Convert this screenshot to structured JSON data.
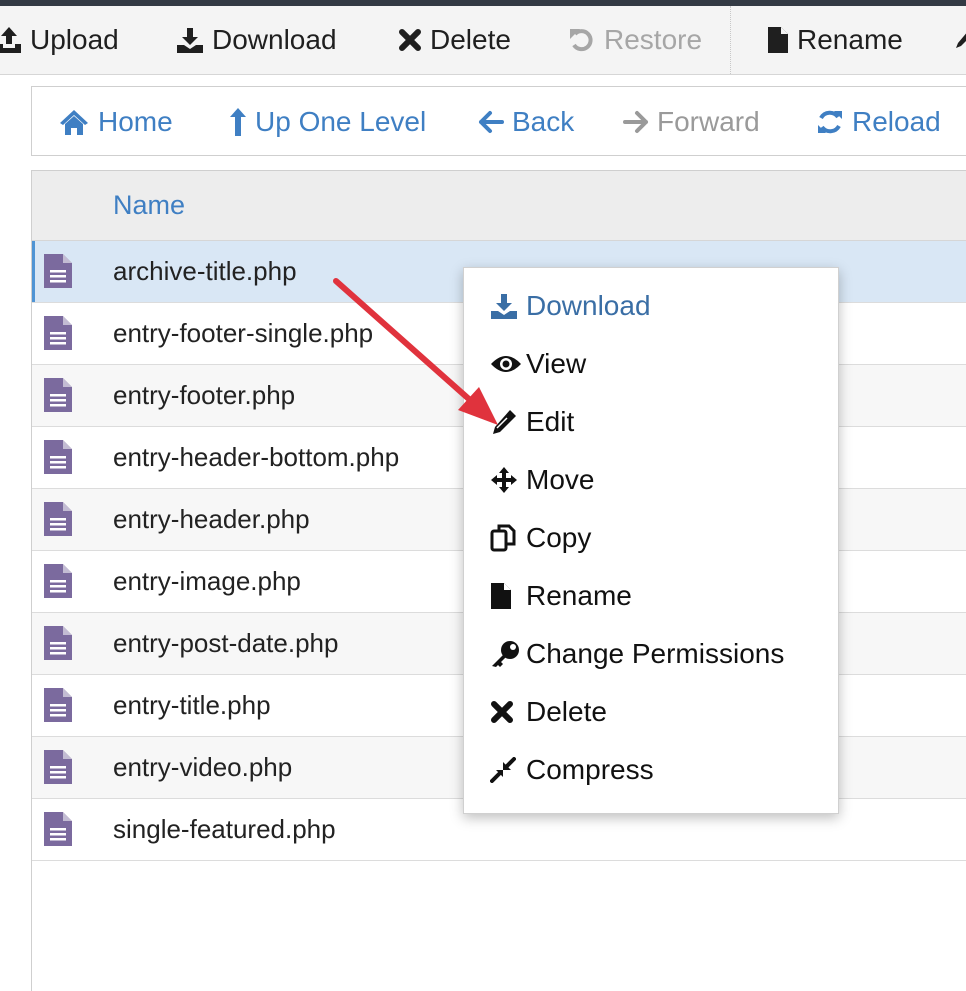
{
  "toolbar": {
    "upload": "Upload",
    "download": "Download",
    "delete": "Delete",
    "restore": "Restore",
    "rename": "Rename"
  },
  "nav": {
    "home": "Home",
    "up": "Up One Level",
    "back": "Back",
    "forward": "Forward",
    "reload": "Reload"
  },
  "list": {
    "name_header": "Name",
    "files": [
      "archive-title.php",
      "entry-footer-single.php",
      "entry-footer.php",
      "entry-header-bottom.php",
      "entry-header.php",
      "entry-image.php",
      "entry-post-date.php",
      "entry-title.php",
      "entry-video.php",
      "single-featured.php"
    ],
    "selected_index": 0
  },
  "context_menu": {
    "items": [
      "Download",
      "View",
      "Edit",
      "Move",
      "Copy",
      "Rename",
      "Change Permissions",
      "Delete",
      "Compress"
    ],
    "icons": [
      "download-icon",
      "eye-icon",
      "pencil-icon",
      "move-icon",
      "copy-icon",
      "file-icon",
      "key-icon",
      "close-icon",
      "compress-icon"
    ]
  },
  "colors": {
    "link_blue": "#3f7fc3",
    "file_icon_purple": "#7b6a9e",
    "annotation_arrow": "#e0333d",
    "selected_row": "#d9e7f5"
  }
}
